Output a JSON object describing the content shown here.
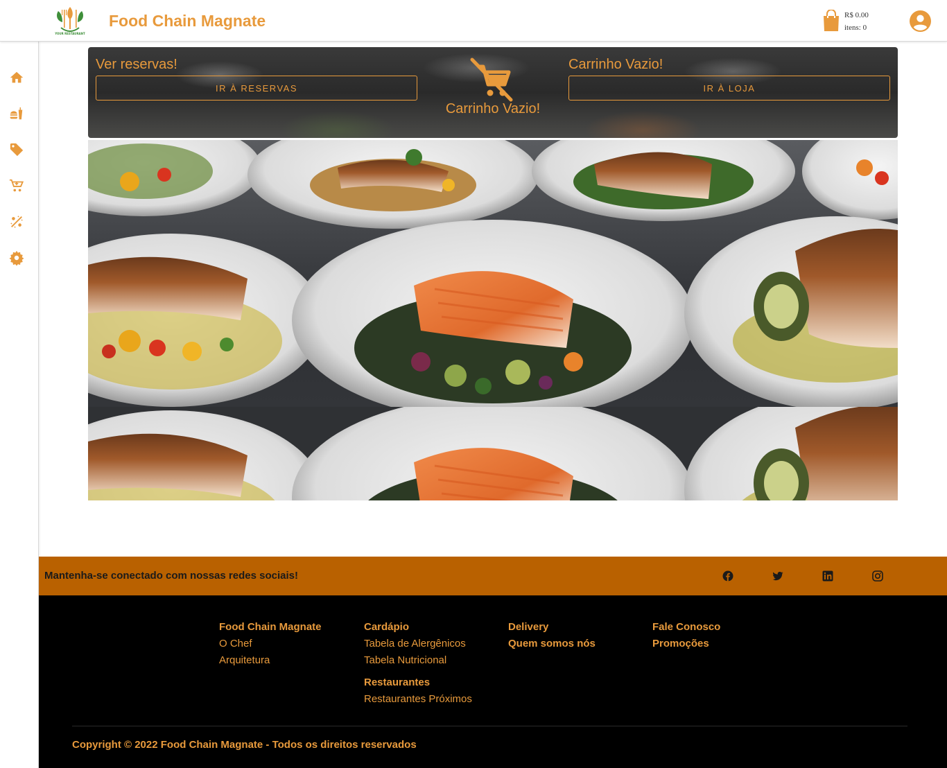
{
  "header": {
    "logo_text": "YOUR RESTAURANT",
    "brand": "Food Chain Magnate",
    "cart_total": "R$ 0.00",
    "cart_items": "itens: 0"
  },
  "sidebar": {
    "items": [
      {
        "icon": "home-icon"
      },
      {
        "icon": "fast-food-icon"
      },
      {
        "icon": "tag-icon"
      },
      {
        "icon": "shopping-cart-icon"
      },
      {
        "icon": "discount-icon"
      },
      {
        "icon": "gear-icon"
      }
    ]
  },
  "banner": {
    "reservations_label": "Ver reservas!",
    "reservations_button": "IR À RESERVAS",
    "cart_status": "Carrinho Vazio!",
    "shop_label": "Carrinho Vazio!",
    "shop_button": "IR À LOJA"
  },
  "social": {
    "text": "Mantenha-se conectado com nossas redes sociais!",
    "icons": [
      "facebook-icon",
      "twitter-icon",
      "linkedin-icon",
      "instagram-icon"
    ]
  },
  "footer": {
    "col1": [
      "Food Chain Magnate",
      "O Chef",
      "Arquitetura"
    ],
    "col2": [
      "Cardápio",
      "Tabela de Alergênicos",
      "Tabela Nutricional",
      "Restaurantes",
      "Restaurantes Próximos"
    ],
    "col3": [
      "Delivery",
      "Quem somos nós"
    ],
    "col4": [
      "Fale Conosco",
      "Promoções"
    ],
    "copyright": "Copyright © 2022 Food Chain Magnate - Todos os direitos reservados"
  },
  "colors": {
    "accent": "#e89a3c",
    "social_bar": "#b96100",
    "footer_bg": "#000000"
  }
}
